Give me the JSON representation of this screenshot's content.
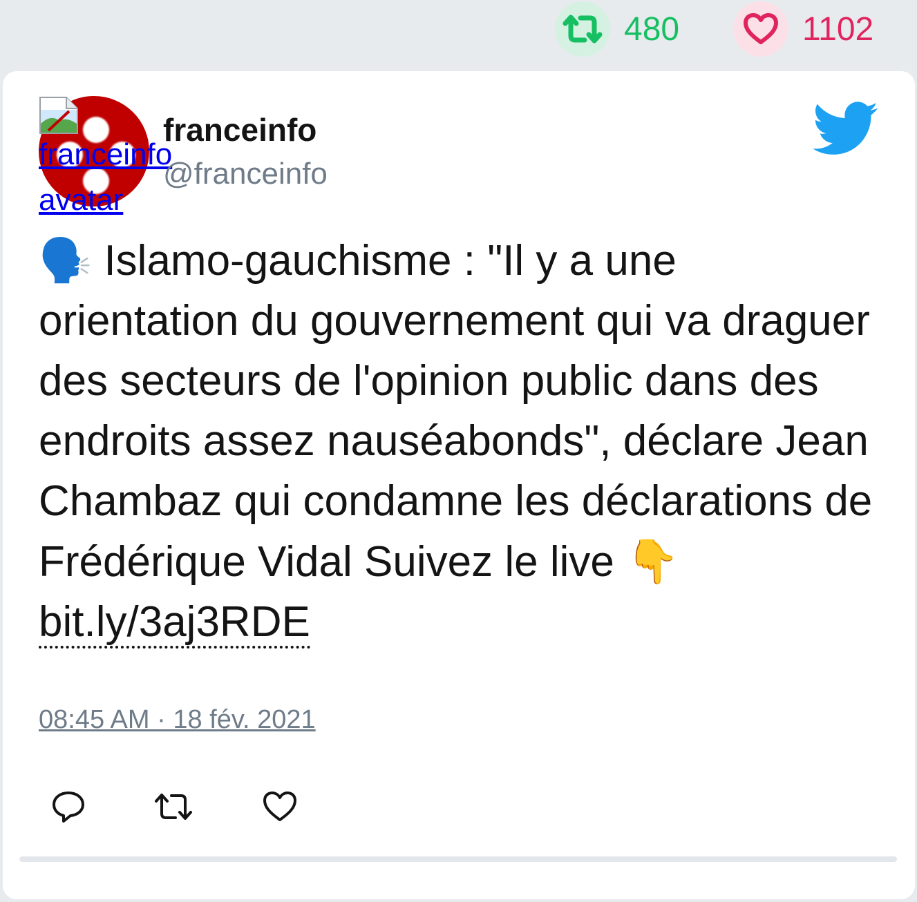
{
  "stats": {
    "retweet_count": "480",
    "like_count": "1102"
  },
  "tweet": {
    "avatar_alt": "franceinfo avatar",
    "display_name": "franceinfo",
    "handle": "@franceinfo",
    "text_emoji": "🗣️",
    "text_body": "Islamo-gauchisme : \"Il y a une orientation du gouvernement qui va draguer des secteurs de l'opinion public dans des endroits assez nauséabonds\", déclare Jean Chambaz qui condamne les déclarations de Frédérique Vidal Suivez le live",
    "pointing_emoji": "👇",
    "link_text": "bit.ly/3aj3RDE",
    "timestamp": "08:45 AM · 18 fév. 2021"
  },
  "icons": {
    "retweet": "retweet-icon",
    "like": "heart-icon",
    "reply": "reply-icon",
    "brand": "twitter-bird-icon"
  },
  "colors": {
    "retweet": "#17bf63",
    "like": "#e0245e",
    "twitter_blue": "#1da1f2",
    "secondary_text": "#6e7b88"
  }
}
